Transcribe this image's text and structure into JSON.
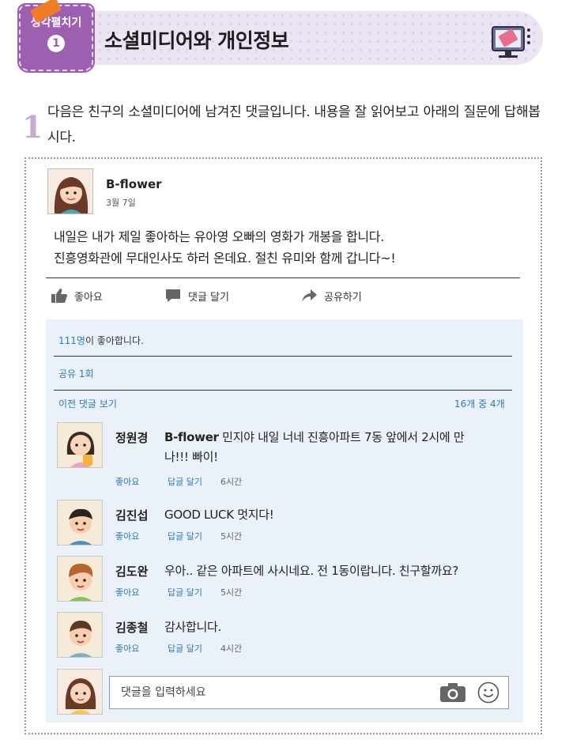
{
  "header": {
    "tag_label": "생각펼치기",
    "tag_number": "1",
    "title": "소셜미디어와 개인정보",
    "icon": "monitor-icon"
  },
  "question": {
    "number": "1",
    "text": "다음은 친구의 소셜미디어에 남겨진 댓글입니다. 내용을 잘 읽어보고 아래의 질문에 답해봅시다."
  },
  "post": {
    "author": "B-flower",
    "date": "3월 7일",
    "body_line1": "내일은 내가 제일 좋아하는 유아영 오빠의 영화가 개봉을 합니다.",
    "body_line2": "진흥영화관에 무대인사도 하러 온데요. 절친 유미와 함께 갑니다~!",
    "actions": {
      "like": "좋아요",
      "comment": "댓글 달기",
      "share": "공유하기"
    }
  },
  "stats": {
    "likes_count": "111명",
    "likes_suffix": "이 좋아합니다.",
    "shares": "공유 1회",
    "prev_comments": "이전 댓글 보기",
    "count": "16개 중 4개"
  },
  "comments": [
    {
      "name": "정원경",
      "ref": "B-flower",
      "text_a": " 민지야 내일 너네 진흥아파트 7동 앞에서 2시에 만",
      "text_b": "나!!! 빠이!",
      "like": "좋아요",
      "reply": "답글 달기",
      "time": "6시간"
    },
    {
      "name": "김진섭",
      "text": "GOOD LUCK 멋지다!",
      "like": "좋아요",
      "reply": "답글 달기",
      "time": "5시간"
    },
    {
      "name": "김도완",
      "text": "우아.. 같은 아파트에 사시네요. 전 1동이랍니다. 친구할까요?",
      "like": "좋아요",
      "reply": "답글 달기",
      "time": "5시간"
    },
    {
      "name": "김종철",
      "text": "감사합니다.",
      "like": "좋아요",
      "reply": "답글 달기",
      "time": "4시간"
    }
  ],
  "input": {
    "placeholder": "댓글을 입력하세요",
    "camera_icon": "camera-icon",
    "emoji_icon": "smiley-icon"
  },
  "colors": {
    "banner": "#ece3f3",
    "tag": "#9d5fb0",
    "link": "#2e7cb6",
    "panel": "#eaf1f9"
  }
}
